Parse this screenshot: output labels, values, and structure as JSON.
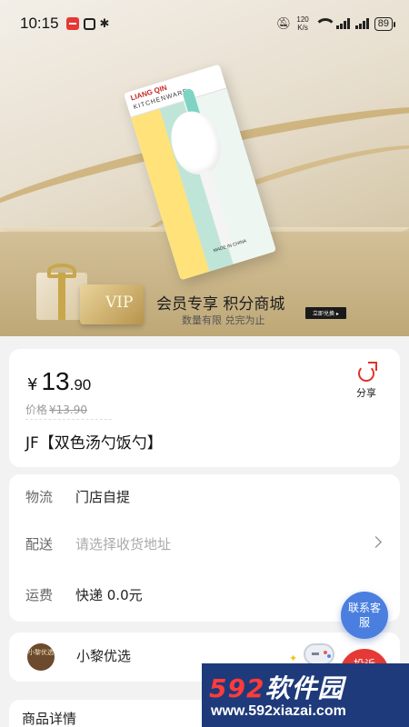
{
  "status_bar": {
    "time": "10:15",
    "net_speed_value": "120",
    "net_speed_unit": "K/s",
    "battery": "89",
    "icons": [
      "message-icon",
      "nfc-icon",
      "bluetooth-icon",
      "mute-icon",
      "wifi-icon",
      "signal-icon",
      "signal-icon",
      "battery-icon"
    ]
  },
  "hero": {
    "package_brand": "LIANG QIN",
    "package_line": "KITCHENWARE",
    "package_made": "MADE IN CHINA",
    "vip_text": "VIP",
    "promo_title": "会员专享 积分商城",
    "promo_subtitle": "数量有限 兑完为止",
    "promo_button": "立即兑换"
  },
  "product": {
    "currency": "¥",
    "price_int": "13",
    "price_dec": ".90",
    "original_label": "价格",
    "original_price": "¥13.90",
    "name": "JF【双色汤勺饭勺】",
    "share_label": "分享"
  },
  "info": {
    "rows": [
      {
        "key": "物流",
        "value": "门店自提"
      },
      {
        "key": "配送",
        "value": "请选择收货地址"
      },
      {
        "key": "运费",
        "value": "快递 0.0元"
      }
    ]
  },
  "shop": {
    "avatar_text": "小黎优选",
    "name": "小黎优选"
  },
  "detail": {
    "title": "商品详情"
  },
  "floating": {
    "customer_service": "联系客服",
    "complain": "投诉"
  },
  "watermark": {
    "logo_num": "592",
    "logo_text": "软件园",
    "url": "www.592xiazai.com"
  },
  "colors": {
    "price_red": "#e0322a",
    "cs_blue": "#4a7fe0",
    "background": "#f2f2f2"
  }
}
